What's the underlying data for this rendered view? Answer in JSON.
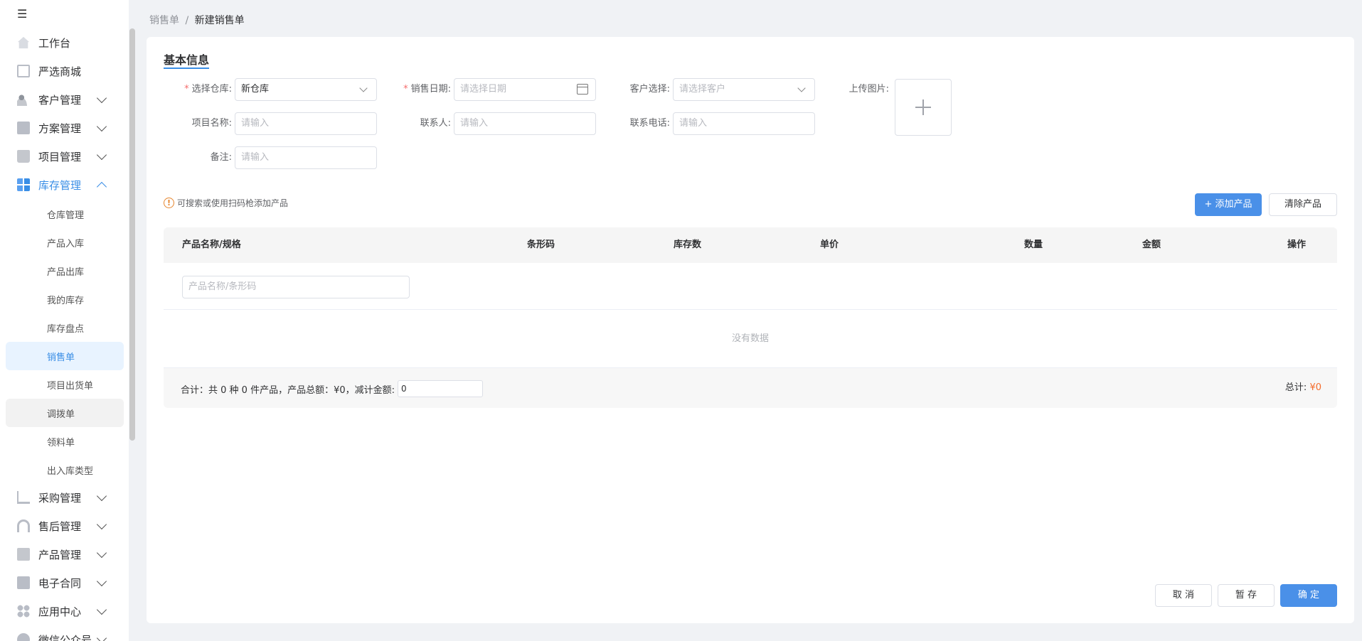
{
  "sidebar": {
    "toggle_icon": "menu-fold-icon",
    "items": [
      {
        "label": "工作台",
        "icon": "home-icon"
      },
      {
        "label": "严选商城",
        "icon": "chart-icon"
      },
      {
        "label": "客户管理",
        "icon": "user-icon"
      },
      {
        "label": "方案管理",
        "icon": "doc-icon"
      },
      {
        "label": "项目管理",
        "icon": "folder-icon"
      },
      {
        "label": "库存管理",
        "icon": "grid-icon"
      }
    ],
    "sub_items": [
      "仓库管理",
      "产品入库",
      "产品出库",
      "我的库存",
      "库存盘点",
      "销售单",
      "项目出货单",
      "调拨单",
      "领料单",
      "出入库类型"
    ],
    "items_after": [
      {
        "label": "采购管理",
        "icon": "cart-icon"
      },
      {
        "label": "售后管理",
        "icon": "headset-icon"
      },
      {
        "label": "产品管理",
        "icon": "box-icon"
      },
      {
        "label": "电子合同",
        "icon": "contract-icon"
      },
      {
        "label": "应用中心",
        "icon": "apps-icon"
      },
      {
        "label": "微信公众号",
        "icon": "wechat-icon"
      }
    ]
  },
  "breadcrumb": {
    "parent": "销售单",
    "sep": "/",
    "current": "新建销售单"
  },
  "form": {
    "section_title": "基本信息",
    "warehouse_label": "选择仓库:",
    "warehouse_value": "新仓库",
    "date_label": "销售日期:",
    "date_placeholder": "请选择日期",
    "customer_label": "客户选择:",
    "customer_placeholder": "请选择客户",
    "upload_label": "上传图片:",
    "project_label": "项目名称:",
    "project_placeholder": "请输入",
    "contact_label": "联系人:",
    "contact_placeholder": "请输入",
    "phone_label": "联系电话:",
    "phone_placeholder": "请输入",
    "remark_label": "备注:",
    "remark_placeholder": "请输入",
    "required_mark": "*"
  },
  "hint": {
    "icon": "!",
    "text": "可搜索或使用扫码枪添加产品"
  },
  "buttons": {
    "add_product": "+ 添加产品",
    "clear_product": "清除产品",
    "cancel": "取 消",
    "save_draft": "暂 存",
    "confirm": "确 定"
  },
  "table": {
    "headers": [
      "产品名称/规格",
      "条形码",
      "库存数",
      "单价",
      "数量",
      "金额",
      "操作"
    ],
    "search_placeholder": "产品名称/条形码",
    "empty_text": "没有数据",
    "summary_text": "合计：共 0 种 0 件产品，产品总额：¥0，减计金额:",
    "discount_value": "0",
    "total_label": "总计:",
    "total_value": "¥0"
  },
  "colors": {
    "accent": "#4a90e8",
    "required": "#f56c6c",
    "amount": "#f56c2c"
  }
}
